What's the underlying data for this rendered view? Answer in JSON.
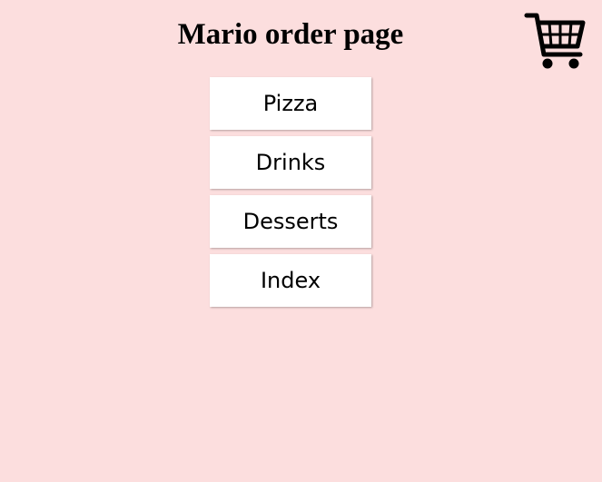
{
  "header": {
    "title": "Mario order page",
    "cart_icon": "shopping-cart-icon"
  },
  "menu": {
    "items": [
      {
        "label": "Pizza"
      },
      {
        "label": "Drinks"
      },
      {
        "label": "Desserts"
      },
      {
        "label": "Index"
      }
    ]
  },
  "colors": {
    "background": "#fcdede",
    "button": "#ffffff",
    "text": "#000000"
  }
}
